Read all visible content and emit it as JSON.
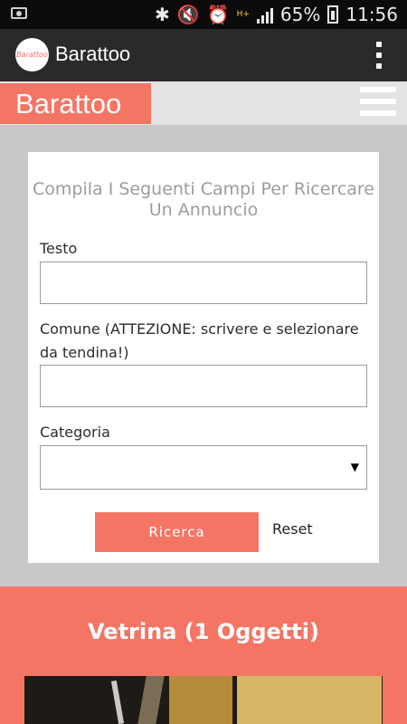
{
  "status": {
    "battery": "65%",
    "time": "11:56",
    "network": "H+"
  },
  "appbar": {
    "title": "Barattoo",
    "logo_text": "Barattoo"
  },
  "site": {
    "brand": "Barattoo"
  },
  "form": {
    "heading": "Compila I Seguenti Campi Per Ricercare Un Annuncio",
    "testo_label": "Testo",
    "testo_value": "",
    "comune_label": "Comune (ATTEZIONE: scrivere e selezionare da tendina!)",
    "comune_value": "",
    "categoria_label": "Categoria",
    "categoria_value": "",
    "search_button": "Ricerca",
    "reset_link": "Reset"
  },
  "vetrina": {
    "title": "Vetrina (1 Oggetti)"
  },
  "colors": {
    "accent": "#f57565",
    "appbar": "#2a2a2a",
    "background": "#c8c8c8"
  }
}
